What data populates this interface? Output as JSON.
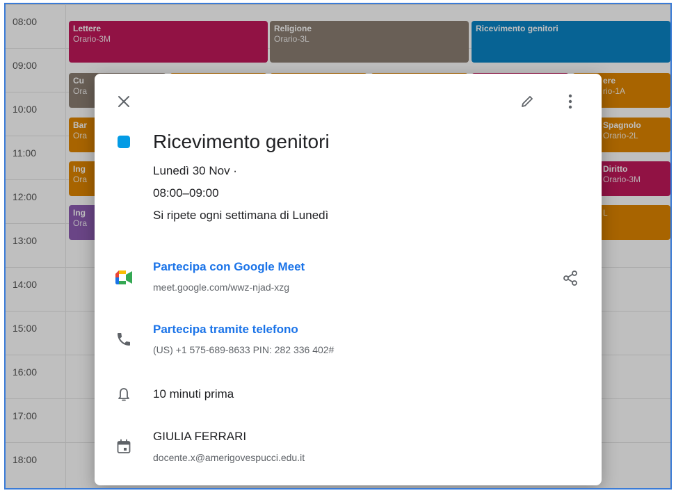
{
  "calendar": {
    "times": [
      "08:00",
      "09:00",
      "10:00",
      "11:00",
      "12:00",
      "13:00",
      "14:00",
      "15:00",
      "16:00",
      "17:00",
      "18:00"
    ],
    "events": [
      {
        "title": "Lettere",
        "subtitle": "Orario-3M",
        "color": "#c2185b"
      },
      {
        "title": "Religione",
        "subtitle": "Orario-3L",
        "color": "#8d7f73"
      },
      {
        "title": "Ricevimento genitori",
        "subtitle": "",
        "color": "#0a84c6"
      },
      {
        "title": "Cu",
        "subtitle": "Ora",
        "color": "#8d7f73"
      },
      {
        "title": "ere",
        "subtitle": "rio-1A",
        "color": "#e08600"
      },
      {
        "title": "Bar",
        "subtitle": "Ora",
        "color": "#e08600"
      },
      {
        "title": "Spagnolo",
        "subtitle": "Orario-2L",
        "color": "#e08600"
      },
      {
        "title": "Ing",
        "subtitle": "Ora",
        "color": "#e08600"
      },
      {
        "title": "Diritto",
        "subtitle": "Orario-3M",
        "color": "#c2185b"
      },
      {
        "title": "Ing",
        "subtitle": "Ora",
        "color": "#8e5db3"
      },
      {
        "title": "",
        "subtitle": "L",
        "color": "#e08600"
      }
    ]
  },
  "dialog": {
    "title": "Ricevimento genitori",
    "date": "Lunedì 30 Nov  ·",
    "time": "08:00–09:00",
    "repeat": "Si ripete ogni settimana di Lunedì",
    "meet_link": "Partecipa con Google Meet",
    "meet_url": "meet.google.com/wwz-njad-xzg",
    "phone_link": "Partecipa tramite telefono",
    "phone_details": "(US) +1 575-689-8633 PIN: 282 336 402#",
    "reminder": "10 minuti prima",
    "organizer_name": "GIULIA FERRARI",
    "organizer_email": "docente.x@amerigovespucci.edu.it",
    "event_color": "#039be5",
    "link_color": "#1a73e8"
  },
  "icons": {
    "close": "close-icon",
    "edit": "pencil-icon",
    "more": "more-vert-icon",
    "meet": "google-meet-icon",
    "share": "share-icon",
    "phone": "phone-icon",
    "bell": "bell-icon",
    "calendar": "calendar-icon"
  }
}
